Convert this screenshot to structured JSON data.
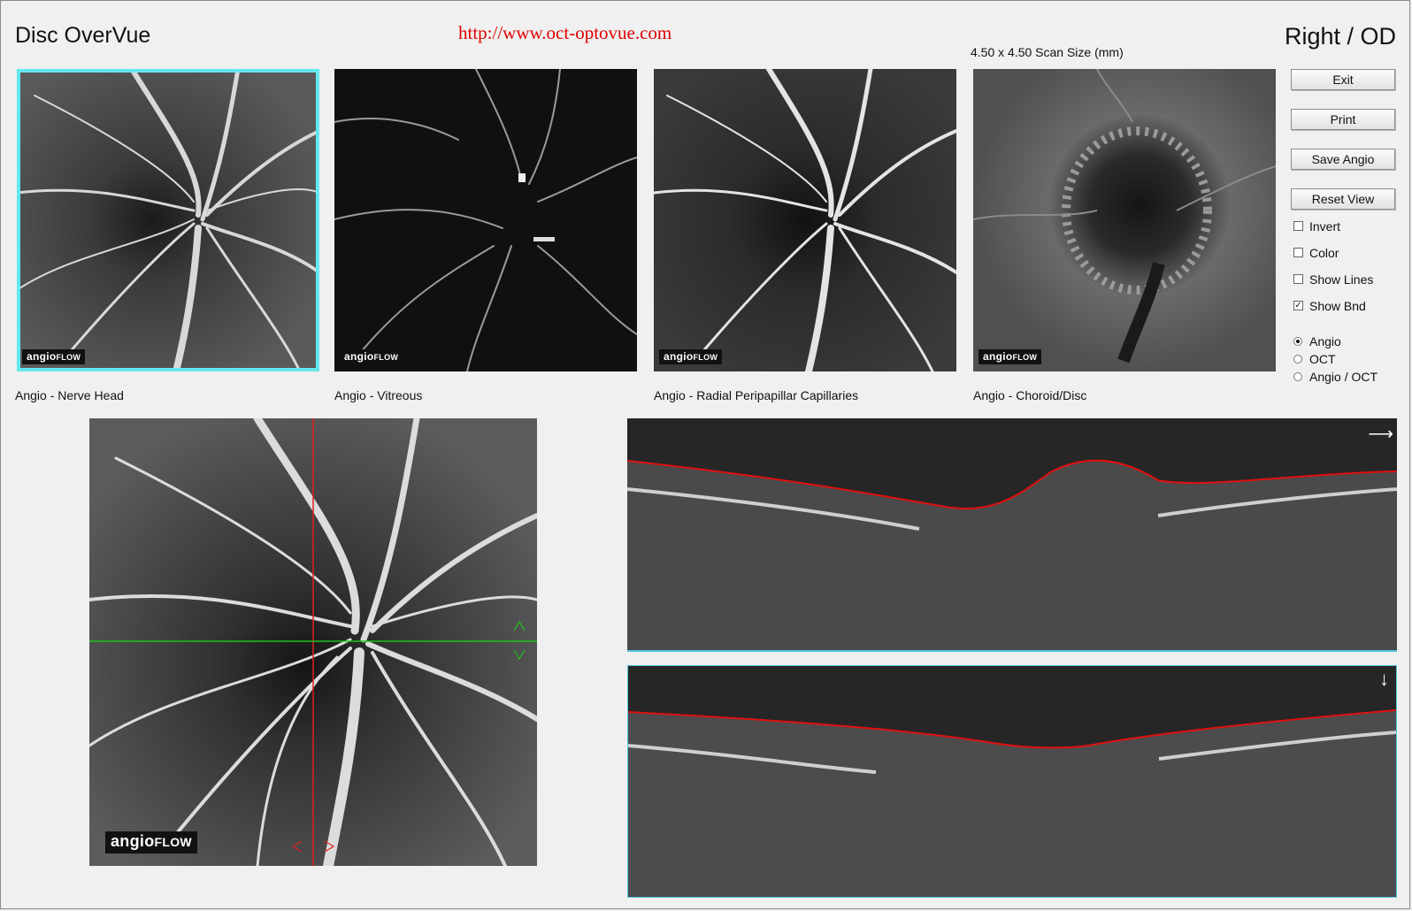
{
  "header": {
    "title": "Disc OverVue",
    "url": "http://www.oct-optovue.com",
    "eye": "Right / OD",
    "scan_size": "4.50 x 4.50 Scan Size (mm)"
  },
  "logo": {
    "main": "angio",
    "suffix": "FLOW"
  },
  "thumbnails": [
    {
      "caption": "Angio - Nerve Head",
      "selected": true
    },
    {
      "caption": "Angio - Vitreous",
      "selected": false
    },
    {
      "caption": "Angio - Radial Peripapillar Capillaries",
      "selected": false
    },
    {
      "caption": "Angio - Choroid/Disc",
      "selected": false
    }
  ],
  "buttons": {
    "exit": "Exit",
    "print": "Print",
    "save_angio": "Save Angio",
    "reset_view": "Reset View"
  },
  "checkboxes": [
    {
      "label": "Invert",
      "checked": false
    },
    {
      "label": "Color",
      "checked": false
    },
    {
      "label": "Show Lines",
      "checked": false
    },
    {
      "label": "Show Bnd",
      "checked": true
    }
  ],
  "radios": [
    {
      "label": "Angio",
      "selected": true
    },
    {
      "label": "OCT",
      "selected": false
    },
    {
      "label": "Angio / OCT",
      "selected": false
    }
  ],
  "colors": {
    "selection": "#63e8f0",
    "url": "#e00000",
    "boundary": "#e01010",
    "crosshair_v": "#e02020",
    "crosshair_h": "#20c020",
    "scan_border": "#52c8e0"
  },
  "icons": {
    "top_scan_direction": "arrow-right-icon",
    "bottom_scan_direction": "arrow-down-icon"
  }
}
